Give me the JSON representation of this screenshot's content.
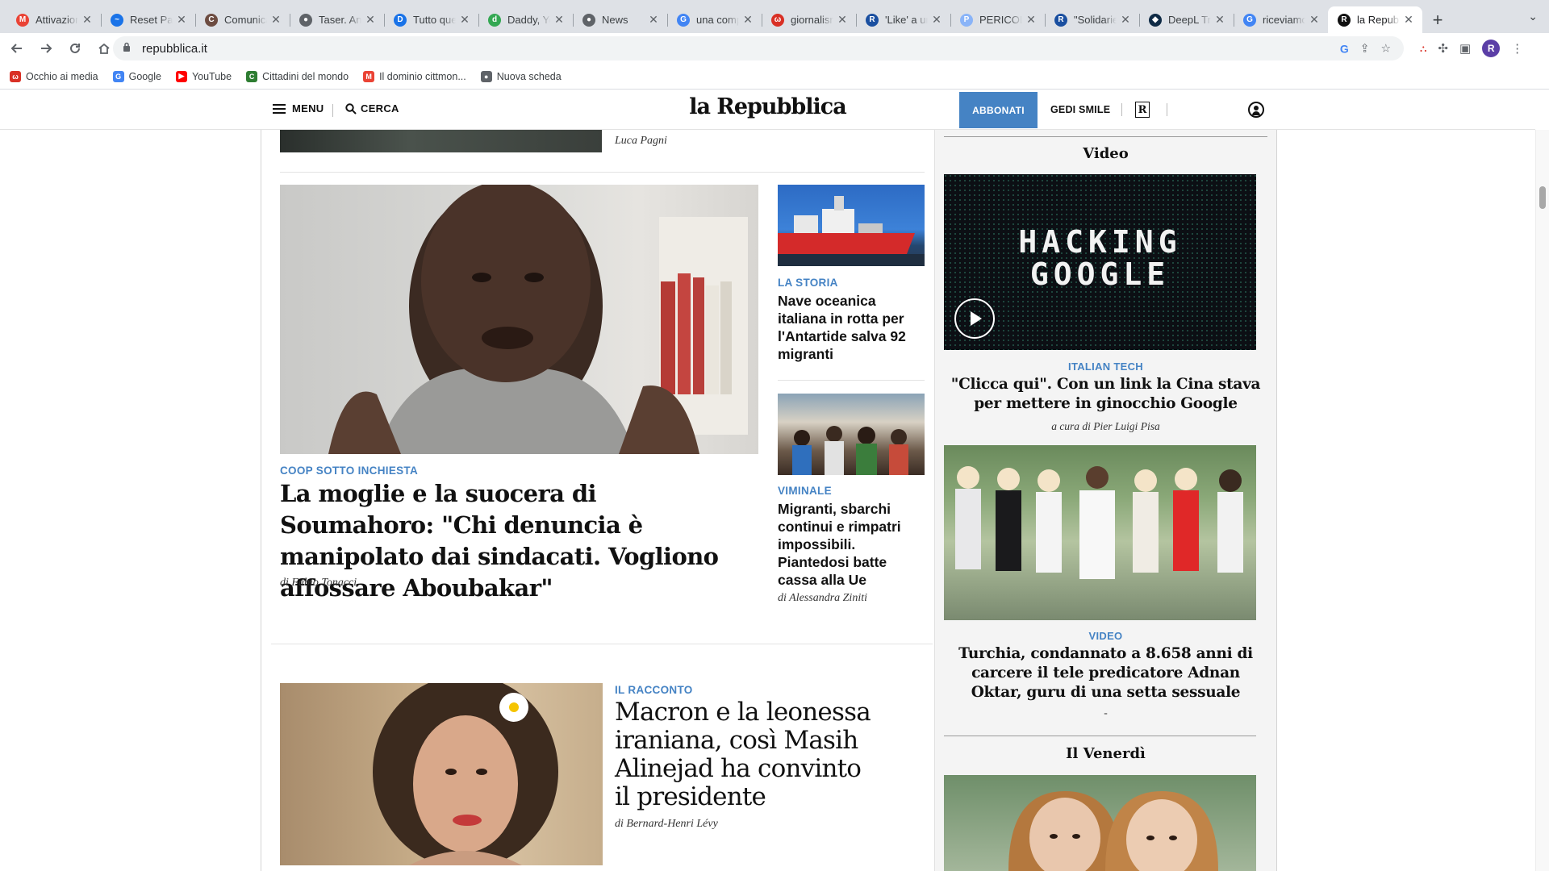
{
  "browser": {
    "tabs": [
      {
        "title": "Attivazion",
        "fav": "M",
        "color": "#ea4335"
      },
      {
        "title": "Reset Pas",
        "fav": "~",
        "color": "#1a73e8"
      },
      {
        "title": "Comunica",
        "fav": "C",
        "color": "#6d4c41"
      },
      {
        "title": "Taser. Ant",
        "fav": "●",
        "color": "#5f6368"
      },
      {
        "title": "Tutto que",
        "fav": "D",
        "color": "#1a73e8"
      },
      {
        "title": "Daddy, Yo",
        "fav": "d",
        "color": "#34a853"
      },
      {
        "title": "News",
        "fav": "●",
        "color": "#5f6368"
      },
      {
        "title": "una comp",
        "fav": "G",
        "color": "#4285f4"
      },
      {
        "title": "giornalism",
        "fav": "ω",
        "color": "#d93025"
      },
      {
        "title": "'Like' a ur",
        "fav": "R",
        "color": "#1a4fa0"
      },
      {
        "title": "PERICOLO",
        "fav": "P",
        "color": "#8ab4f8"
      },
      {
        "title": "\"Solidarie",
        "fav": "R",
        "color": "#1a4fa0"
      },
      {
        "title": "DeepL Tra",
        "fav": "◆",
        "color": "#0f2b46"
      },
      {
        "title": "riceviamo",
        "fav": "G",
        "color": "#4285f4"
      },
      {
        "title": "la Repubb",
        "fav": "R",
        "color": "#111111"
      }
    ],
    "active_tab_index": 14,
    "url": "repubblica.it",
    "avatar_letter": "R",
    "bookmarks": [
      {
        "label": "Occhio ai media",
        "icon": "ω",
        "color": "#d93025"
      },
      {
        "label": "Google",
        "icon": "G",
        "color": "#4285f4"
      },
      {
        "label": "YouTube",
        "icon": "▶",
        "color": "#ff0000"
      },
      {
        "label": "Cittadini del mondo",
        "icon": "C",
        "color": "#2e7d32"
      },
      {
        "label": "Il dominio cittmon...",
        "icon": "M",
        "color": "#ea4335"
      },
      {
        "label": "Nuova scheda",
        "icon": "●",
        "color": "#5f6368"
      }
    ]
  },
  "site": {
    "menu_label": "MENU",
    "search_label": "CERCA",
    "logo_text": "la Repubblica",
    "subscribe_label": "ABBONATI",
    "gedi_label": "GEDI SMILE",
    "r_badge": "R"
  },
  "articles": {
    "top_byline": "Luca Pagni",
    "main": {
      "kicker": "COOP SOTTO INCHIESTA",
      "title": "La moglie e la suocera di Soumahoro: \"Chi denuncia è manipolato dai sindacati. Vogliono affossare Aboubakar\"",
      "byline": "di Fabio Tonacci"
    },
    "side1": {
      "kicker": "LA STORIA",
      "title": "Nave oceanica italiana in rotta per l'Antartide salva 92 migranti"
    },
    "side2": {
      "kicker": "VIMINALE",
      "title": "Migranti, sbarchi continui e rimpatri impossibili. Piantedosi batte cassa alla Ue",
      "byline": "di Alessandra Ziniti"
    },
    "bottom": {
      "kicker": "IL RACCONTO",
      "title": "Macron e la leonessa iraniana, così Masih Alinejad ha convinto il presidente",
      "byline": "di Bernard-Henri Lévy"
    }
  },
  "sidebar": {
    "video_section": "Video",
    "video_thumb_text": [
      "HACKING",
      "GOOGLE"
    ],
    "item1": {
      "kicker": "ITALIAN TECH",
      "title": "\"Clicca qui\". Con un link la Cina stava per mettere in ginocchio Google",
      "byline": "a cura di Pier Luigi Pisa"
    },
    "item2": {
      "kicker": "VIDEO",
      "title": "Turchia, condannato a 8.658 anni di carcere il tele predicatore Adnan Oktar, guru di una setta sessuale",
      "dash": "-"
    },
    "venerdi_section": "Il Venerdì"
  },
  "colors": {
    "accent": "#4583c4",
    "chrome_bg": "#dee1e6"
  }
}
